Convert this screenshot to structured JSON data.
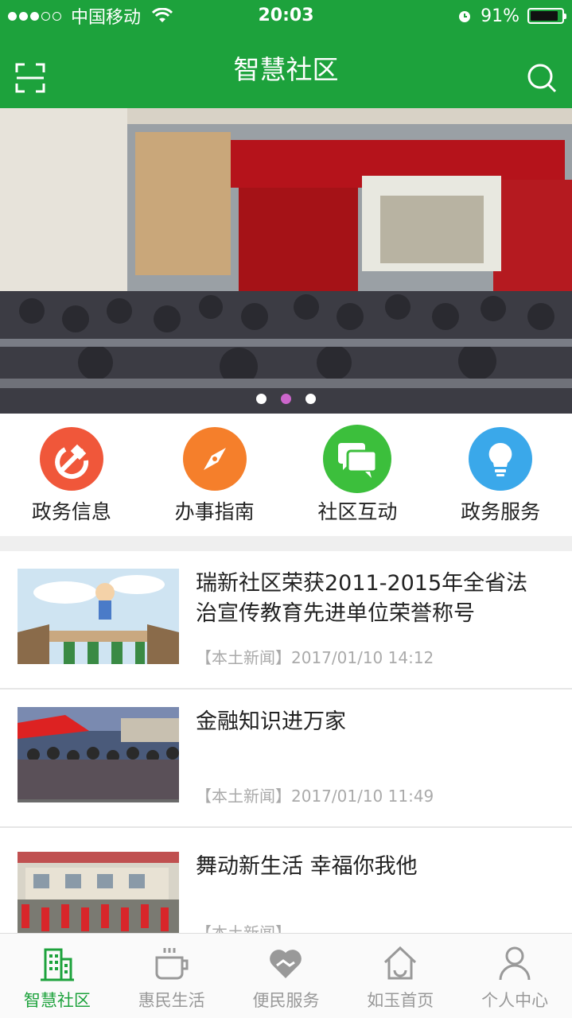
{
  "status_bar": {
    "carrier": "中国移动",
    "time": "20:03",
    "battery_text": "91%",
    "battery_level": 0.91
  },
  "nav": {
    "title": "智慧社区",
    "left_icon": "scan-icon",
    "right_icon": "search-icon"
  },
  "banner": {
    "slide_count": 3,
    "active_slide": 2
  },
  "quick_menu": [
    {
      "label": "政务信息",
      "icon": "party-emblem-icon",
      "color": "#f0573a"
    },
    {
      "label": "办事指南",
      "icon": "compass-icon",
      "color": "#f57f2b"
    },
    {
      "label": "社区互动",
      "icon": "chat-bubbles-icon",
      "color": "#3cbf3c"
    },
    {
      "label": "政务服务",
      "icon": "lightbulb-icon",
      "color": "#3aa8ea"
    }
  ],
  "news": [
    {
      "title": "瑞新社区荣获2011-2015年全省法治宣传教育先进单位荣誉称号",
      "meta": "【本土新闻】2017/01/10 14:12"
    },
    {
      "title": "金融知识进万家",
      "meta": "【本土新闻】2017/01/10 11:49"
    },
    {
      "title": "舞动新生活 幸福你我他",
      "meta": "【本土新闻】"
    }
  ],
  "tab_bar": [
    {
      "label": "智慧社区",
      "icon": "building-icon",
      "active": true
    },
    {
      "label": "惠民生活",
      "icon": "coffee-cup-icon",
      "active": false
    },
    {
      "label": "便民服务",
      "icon": "heart-handshake-icon",
      "active": false
    },
    {
      "label": "如玉首页",
      "icon": "home-icon",
      "active": false
    },
    {
      "label": "个人中心",
      "icon": "user-icon",
      "active": false
    }
  ],
  "colors": {
    "brand_green": "#1da23c",
    "inactive_gray": "#999999",
    "dot_active": "#cc66cc"
  }
}
